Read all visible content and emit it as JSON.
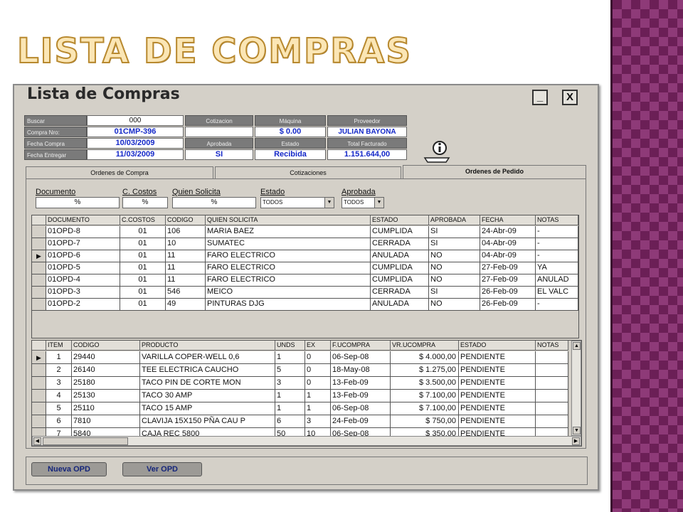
{
  "slide": {
    "title": "LISTA DE COMPRAS"
  },
  "window": {
    "title": "Lista de Compras",
    "minimize_label": "_",
    "close_label": "X"
  },
  "header": {
    "buscar": {
      "label": "Buscar",
      "value": "000"
    },
    "compra_nro": {
      "label": "Compra Nro:",
      "value": "01CMP-396"
    },
    "fecha_compra": {
      "label": "Fecha Compra",
      "value": "10/03/2009"
    },
    "fecha_entregar": {
      "label": "Fecha Entregar",
      "value": "11/03/2009"
    },
    "cotizacion": {
      "label": "Cotizacion",
      "value": ""
    },
    "aprobada": {
      "label": "Aprobada",
      "value": "SI"
    },
    "maquina": {
      "label": "Máquina",
      "value": "$ 0.00"
    },
    "estado": {
      "label": "Estado",
      "value": "Recibida"
    },
    "proveedor": {
      "label": "Proveedor",
      "value": "JULIAN BAYONA"
    },
    "total_facturado": {
      "label": "Total Facturado",
      "value": "1.151.644,00"
    }
  },
  "tabs": [
    {
      "label": "Ordenes de Compra"
    },
    {
      "label": "Cotizaciones"
    },
    {
      "label": "Ordenes de Pedido",
      "active": true
    }
  ],
  "filters": {
    "documento": {
      "label": "Documento",
      "value": "%"
    },
    "c_costos": {
      "label": "C. Costos",
      "value": "%"
    },
    "quien_solicita": {
      "label": "Quien Solicita",
      "value": "%"
    },
    "estado": {
      "label": "Estado",
      "value": "TODOS"
    },
    "aprobada": {
      "label": "Aprobada",
      "value": "TODOS"
    }
  },
  "orders_table": {
    "columns": [
      "DOCUMENTO",
      "C.COSTOS",
      "CODIGO",
      "QUIEN SOLICITA",
      "ESTADO",
      "APROBADA",
      "FECHA",
      "NOTAS"
    ],
    "rows": [
      [
        "01OPD-8",
        "01",
        "106",
        "MARIA BAEZ",
        "CUMPLIDA",
        "SI",
        "24-Abr-09",
        "-"
      ],
      [
        "01OPD-7",
        "01",
        "10",
        "SUMATEC",
        "CERRADA",
        "SI",
        "04-Abr-09",
        "-"
      ],
      [
        "01OPD-6",
        "01",
        "11",
        "FARO ELECTRICO",
        "ANULADA",
        "NO",
        "04-Abr-09",
        "-"
      ],
      [
        "01OPD-5",
        "01",
        "11",
        "FARO ELECTRICO",
        "CUMPLIDA",
        "NO",
        "27-Feb-09",
        "YA"
      ],
      [
        "01OPD-4",
        "01",
        "11",
        "FARO ELECTRICO",
        "CUMPLIDA",
        "NO",
        "27-Feb-09",
        "ANULAD"
      ],
      [
        "01OPD-3",
        "01",
        "546",
        "MEICO",
        "CERRADA",
        "SI",
        "26-Feb-09",
        "EL VALC"
      ],
      [
        "01OPD-2",
        "01",
        "49",
        "PINTURAS DJG",
        "ANULADA",
        "NO",
        "26-Feb-09",
        "-"
      ]
    ],
    "selected_row": 2
  },
  "items_table": {
    "columns": [
      "ITEM",
      "CODIGO",
      "PRODUCTO",
      "UNDS",
      "EX",
      "F.UCOMPRA",
      "VR.UCOMPRA",
      "ESTADO",
      "NOTAS"
    ],
    "rows": [
      [
        "1",
        "29440",
        "VARILLA COPER-WELL 0,6",
        "1",
        "0",
        "06-Sep-08",
        "$ 4.000,00",
        "PENDIENTE",
        ""
      ],
      [
        "2",
        "26140",
        "TEE ELECTRICA CAUCHO",
        "5",
        "0",
        "18-May-08",
        "$ 1.275,00",
        "PENDIENTE",
        ""
      ],
      [
        "3",
        "25180",
        "TACO PIN DE CORTE MON",
        "3",
        "0",
        "13-Feb-09",
        "$ 3.500,00",
        "PENDIENTE",
        ""
      ],
      [
        "4",
        "25130",
        "TACO 30 AMP",
        "1",
        "1",
        "13-Feb-09",
        "$ 7.100,00",
        "PENDIENTE",
        ""
      ],
      [
        "5",
        "25110",
        "TACO 15 AMP",
        "1",
        "1",
        "06-Sep-08",
        "$ 7.100,00",
        "PENDIENTE",
        ""
      ],
      [
        "6",
        "7810",
        "CLAVIJA 15X150 PÑA CAU P",
        "6",
        "3",
        "24-Feb-09",
        "$ 750,00",
        "PENDIENTE",
        ""
      ],
      [
        "7",
        "5840",
        "CAJA REC 5800",
        "50",
        "10",
        "06-Sep-08",
        "$ 350,00",
        "PENDIENTE",
        ""
      ]
    ],
    "selected_row": 0
  },
  "buttons": {
    "nueva_opd": "Nueva OPD",
    "ver_opd": "Ver OPD"
  },
  "colors": {
    "value_blue": "#1428c8",
    "title_gold": "#fbe6b5",
    "deco_purple": "#6b1f56"
  }
}
